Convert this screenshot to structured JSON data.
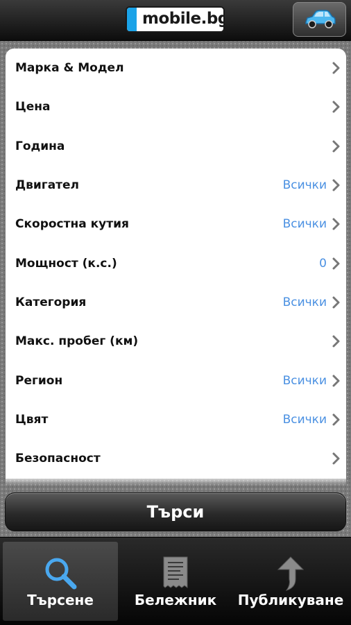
{
  "header": {
    "logo_text": "mobile.bg",
    "car_button_icon": "car-icon",
    "brand_color": "#1aa3e8"
  },
  "filters": [
    {
      "label": "Марка & Модел",
      "value": ""
    },
    {
      "label": "Цена",
      "value": ""
    },
    {
      "label": "Година",
      "value": ""
    },
    {
      "label": "Двигател",
      "value": "Всички"
    },
    {
      "label": "Скоростна кутия",
      "value": "Всички"
    },
    {
      "label": "Мощност (к.с.)",
      "value": "0"
    },
    {
      "label": "Категория",
      "value": "Всички"
    },
    {
      "label": "Макс. пробег (км)",
      "value": ""
    },
    {
      "label": "Регион",
      "value": "Всички"
    },
    {
      "label": "Цвят",
      "value": "Всички"
    },
    {
      "label": "Безопасност",
      "value": ""
    }
  ],
  "value_color": "#4a90e2",
  "search_button": {
    "label": "Търси"
  },
  "tabs": [
    {
      "label": "Търсене",
      "icon": "magnifier-icon",
      "active": true
    },
    {
      "label": "Бележник",
      "icon": "receipt-icon",
      "active": false
    },
    {
      "label": "Публикуване",
      "icon": "upload-arrow-icon",
      "active": false
    }
  ]
}
